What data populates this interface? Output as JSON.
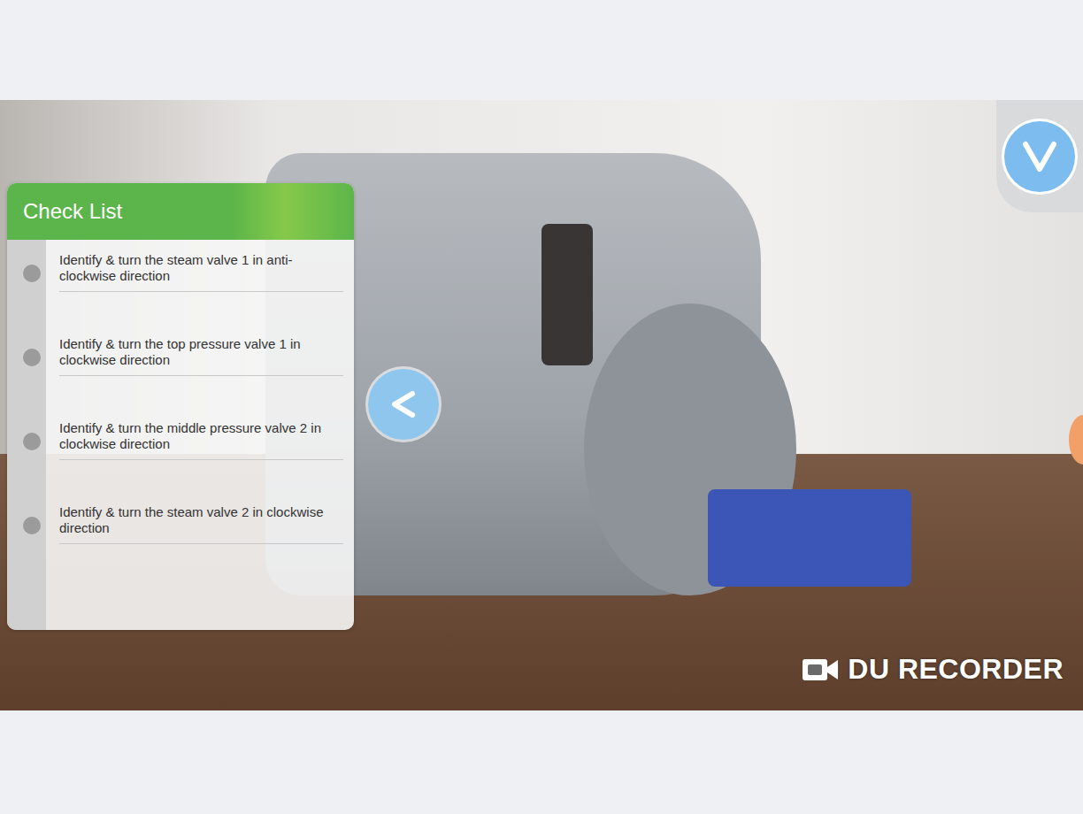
{
  "checklist": {
    "title": "Check List",
    "items": [
      {
        "text": "Identify & turn the steam valve 1 in anti-clockwise direction",
        "checked": false
      },
      {
        "text": "Identify & turn the top pressure valve 1 in clockwise direction",
        "checked": false
      },
      {
        "text": "Identify & turn the middle pressure valve 2 in clockwise direction",
        "checked": false
      },
      {
        "text": "Identify & turn the steam valve 2 in clockwise direction",
        "checked": false
      }
    ]
  },
  "recorder": {
    "label": "DU RECORDER"
  }
}
